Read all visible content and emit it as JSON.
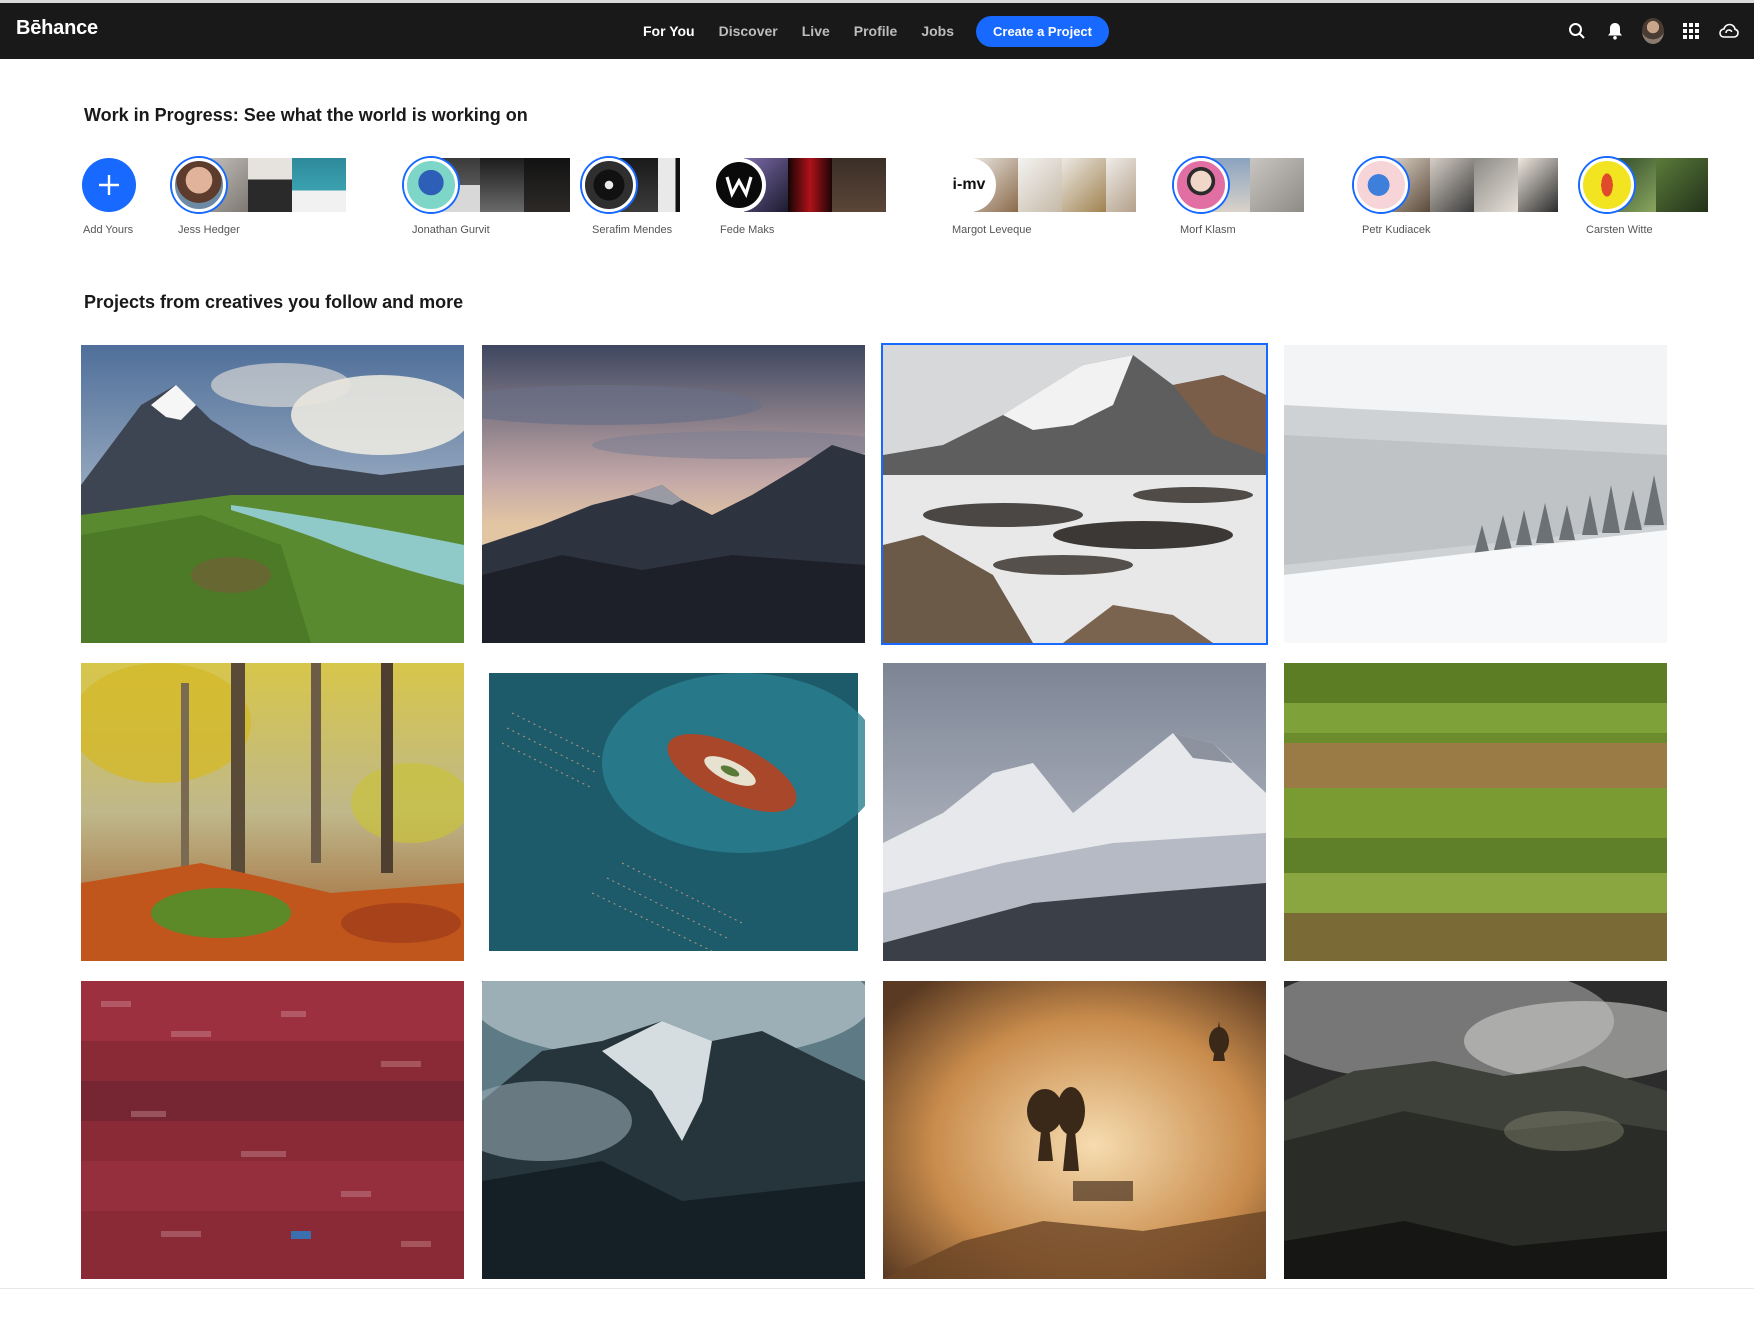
{
  "app": {
    "logo": "Bēhance"
  },
  "nav": {
    "links": [
      {
        "label": "For You",
        "active": true
      },
      {
        "label": "Discover",
        "active": false
      },
      {
        "label": "Live",
        "active": false
      },
      {
        "label": "Profile",
        "active": false
      },
      {
        "label": "Jobs",
        "active": false
      }
    ],
    "create_label": "Create a Project",
    "icons": [
      "search-icon",
      "bell-icon",
      "avatar",
      "apps-grid-icon",
      "creative-cloud-icon"
    ]
  },
  "wip": {
    "title": "Work in Progress: See what the world is working on",
    "add_label": "Add Yours",
    "people": [
      {
        "name": "Jess Hedger"
      },
      {
        "name": "Jonathan Gurvit"
      },
      {
        "name": "Serafim Mendes"
      },
      {
        "name": "Fede Maks"
      },
      {
        "name": "Margot Leveque",
        "logo_text": "i-mv"
      },
      {
        "name": "Morf Klasm"
      },
      {
        "name": "Petr Kudiacek"
      },
      {
        "name": "Carsten Witte"
      }
    ]
  },
  "projects": {
    "title": "Projects from creatives you follow and more",
    "items": [
      {
        "subject": "mountain-lake-landscape"
      },
      {
        "subject": "jagged-peaks-sunset"
      },
      {
        "subject": "snowy-glacier-lake",
        "selected": true
      },
      {
        "subject": "snowy-forest-slope"
      },
      {
        "subject": "autumn-forest"
      },
      {
        "subject": "aerial-island-ocean"
      },
      {
        "subject": "snowy-mountain-ridge"
      },
      {
        "subject": "aerial-green-fields"
      },
      {
        "subject": "red-village-hillside"
      },
      {
        "subject": "misty-snow-peak"
      },
      {
        "subject": "golden-fog-trees"
      },
      {
        "subject": "dark-cloudy-mountains"
      }
    ]
  },
  "colors": {
    "accent": "#1769ff",
    "navbar": "#191919"
  }
}
